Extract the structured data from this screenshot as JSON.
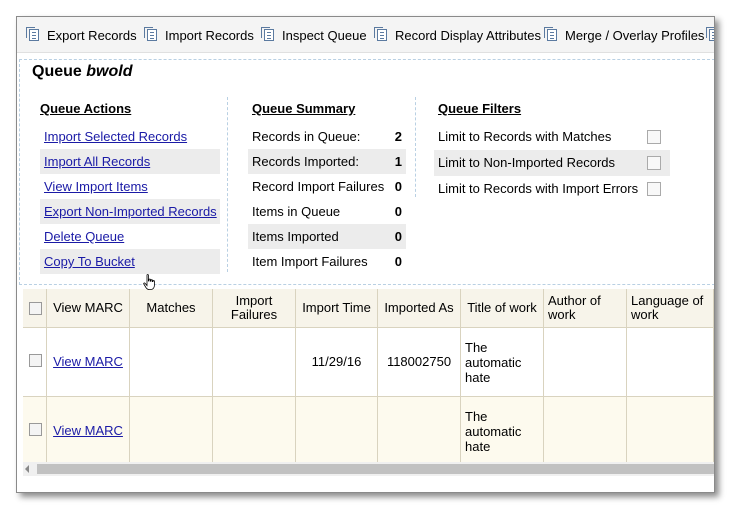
{
  "toolbar": {
    "items": [
      {
        "label": "Export Records",
        "icon": "records-icon"
      },
      {
        "label": "Import Records",
        "icon": "records-icon"
      },
      {
        "label": "Inspect Queue",
        "icon": "records-icon"
      },
      {
        "label": "Record Display Attributes",
        "icon": "records-icon"
      },
      {
        "label": "Merge / Overlay Profiles",
        "icon": "records-icon"
      }
    ]
  },
  "queue": {
    "label": "Queue",
    "name": "bwold"
  },
  "actions": {
    "heading": "Queue Actions",
    "items": [
      "Import Selected Records",
      "Import All Records",
      "View Import Items",
      "Export Non-Imported Records",
      "Delete Queue",
      "Copy To Bucket"
    ]
  },
  "summary": {
    "heading": "Queue Summary",
    "items": [
      {
        "label": "Records in Queue:",
        "value": "2"
      },
      {
        "label": "Records Imported:",
        "value": "1"
      },
      {
        "label": "Record Import Failures",
        "value": "0"
      },
      {
        "label": "Items in Queue",
        "value": "0"
      },
      {
        "label": "Items Imported",
        "value": "0"
      },
      {
        "label": "Item Import Failures",
        "value": "0"
      }
    ]
  },
  "filters": {
    "heading": "Queue Filters",
    "items": [
      {
        "label": "Limit to Records with Matches",
        "checked": false
      },
      {
        "label": "Limit to Non-Imported Records",
        "checked": false
      },
      {
        "label": "Limit to Records with Import Errors",
        "checked": false
      }
    ]
  },
  "grid": {
    "columns": [
      "View MARC",
      "Matches",
      "Import Failures",
      "Import Time",
      "Imported As",
      "Title of work",
      "Author of work",
      "Language of work"
    ],
    "rows": [
      {
        "view_marc": "View MARC",
        "matches": "",
        "import_failures": "",
        "import_time": "11/29/16",
        "imported_as": "118002750",
        "title": "The automatic hate",
        "author": "",
        "language": ""
      },
      {
        "view_marc": "View MARC",
        "matches": "",
        "import_failures": "",
        "import_time": "",
        "imported_as": "",
        "title": "The automatic hate",
        "author": "",
        "language": ""
      }
    ]
  },
  "colors": {
    "link": "#1a1aa6",
    "shade": "#ececec",
    "grid_header": "#f7f4ea",
    "alt_row": "#fdfaee"
  }
}
